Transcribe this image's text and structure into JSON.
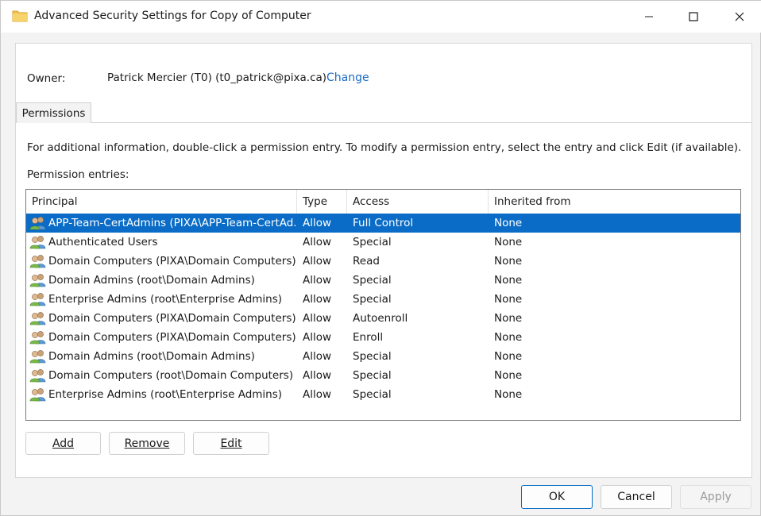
{
  "window": {
    "title": "Advanced Security Settings for Copy of Computer"
  },
  "owner": {
    "label": "Owner:",
    "value": "Patrick Mercier (T0) (t0_patrick@pixa.ca)",
    "change_link": "Change"
  },
  "tabs": [
    {
      "label": "Permissions",
      "active": true
    }
  ],
  "info_text": "For additional information, double-click a permission entry. To modify a permission entry, select the entry and click Edit (if available).",
  "entries_label": "Permission entries:",
  "columns": {
    "principal": "Principal",
    "type": "Type",
    "access": "Access",
    "inherited_from": "Inherited from"
  },
  "entries": [
    {
      "principal": "APP-Team-CertAdmins (PIXA\\APP-Team-CertAd...",
      "type": "Allow",
      "access": "Full Control",
      "inherited_from": "None",
      "selected": true
    },
    {
      "principal": "Authenticated Users",
      "type": "Allow",
      "access": "Special",
      "inherited_from": "None"
    },
    {
      "principal": "Domain Computers (PIXA\\Domain Computers)",
      "type": "Allow",
      "access": "Read",
      "inherited_from": "None"
    },
    {
      "principal": "Domain Admins (root\\Domain Admins)",
      "type": "Allow",
      "access": "Special",
      "inherited_from": "None"
    },
    {
      "principal": "Enterprise Admins (root\\Enterprise Admins)",
      "type": "Allow",
      "access": "Special",
      "inherited_from": "None"
    },
    {
      "principal": "Domain Computers (PIXA\\Domain Computers)",
      "type": "Allow",
      "access": "Autoenroll",
      "inherited_from": "None"
    },
    {
      "principal": "Domain Computers (PIXA\\Domain Computers)",
      "type": "Allow",
      "access": "Enroll",
      "inherited_from": "None"
    },
    {
      "principal": "Domain Admins (root\\Domain Admins)",
      "type": "Allow",
      "access": "Special",
      "inherited_from": "None"
    },
    {
      "principal": "Domain Computers (root\\Domain Computers)",
      "type": "Allow",
      "access": "Special",
      "inherited_from": "None"
    },
    {
      "principal": "Enterprise Admins (root\\Enterprise Admins)",
      "type": "Allow",
      "access": "Special",
      "inherited_from": "None"
    }
  ],
  "buttons": {
    "add": "Add",
    "remove": "Remove",
    "edit": "Edit",
    "ok": "OK",
    "cancel": "Cancel",
    "apply": "Apply"
  },
  "icons": {
    "title": "folder-icon",
    "row": "users-group-icon",
    "minimize": "minimize-icon",
    "maximize": "maximize-icon",
    "close": "close-icon"
  },
  "colors": {
    "selection": "#0a6cc6",
    "link": "#1a6bc4",
    "folder": "#f2c14e"
  }
}
